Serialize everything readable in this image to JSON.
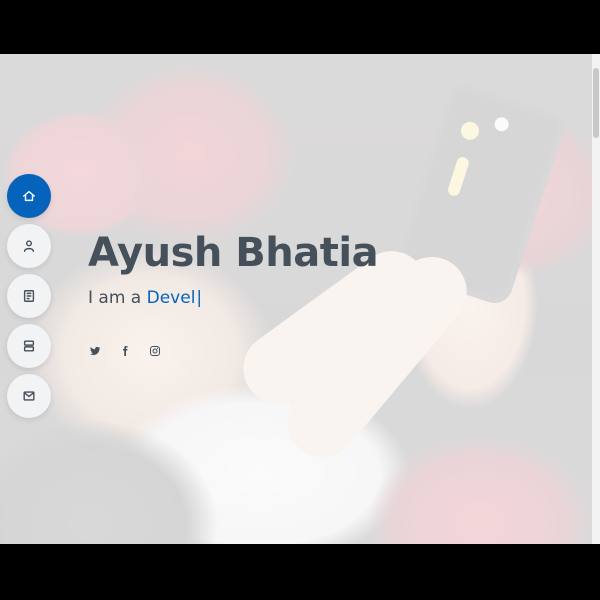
{
  "hero": {
    "name": "Ayush Bhatia",
    "tagline_prefix": "I am a ",
    "typed_text": "Devel",
    "cursor": "|"
  },
  "nav": {
    "items": [
      {
        "icon": "home-icon",
        "active": true
      },
      {
        "icon": "person-icon",
        "active": false
      },
      {
        "icon": "file-icon",
        "active": false
      },
      {
        "icon": "server-icon",
        "active": false
      },
      {
        "icon": "envelope-icon",
        "active": false
      }
    ]
  },
  "social": [
    "twitter-icon",
    "facebook-icon",
    "instagram-icon"
  ],
  "colors": {
    "accent": "#0563bb",
    "text": "#45505b",
    "nav_bg": "#f2f3f5"
  }
}
